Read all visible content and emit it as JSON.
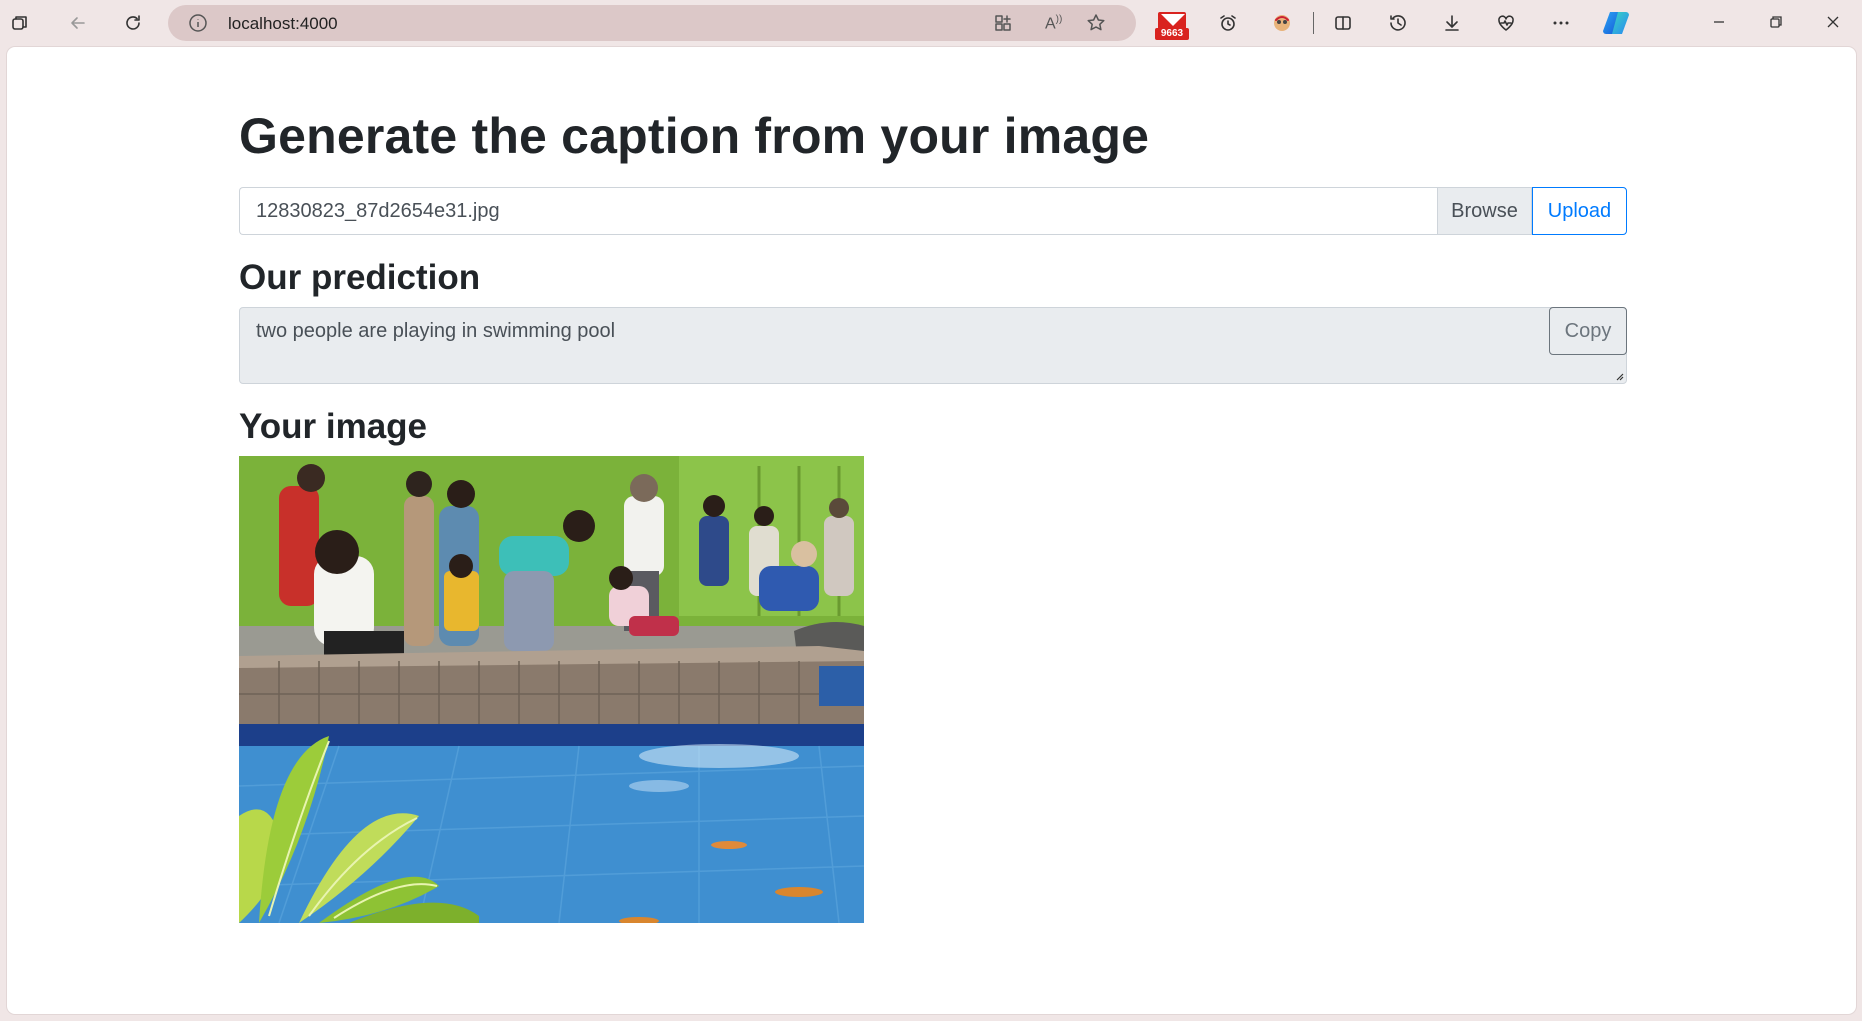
{
  "browser": {
    "url": "localhost:4000",
    "mail_badge_count": "9663"
  },
  "page": {
    "title": "Generate the caption from your image",
    "file_input": {
      "value": "12830823_87d2654e31.jpg",
      "browse_label": "Browse",
      "upload_label": "Upload"
    },
    "prediction": {
      "heading": "Our prediction",
      "text": "two people are playing in swimming pool",
      "copy_label": "Copy"
    },
    "image_section": {
      "heading": "Your image"
    }
  },
  "colors": {
    "accent": "#007bff",
    "chrome_bg": "#f0e6e6",
    "address_bar_bg": "#dcc8c8",
    "readonly_bg": "#e9ecef"
  }
}
